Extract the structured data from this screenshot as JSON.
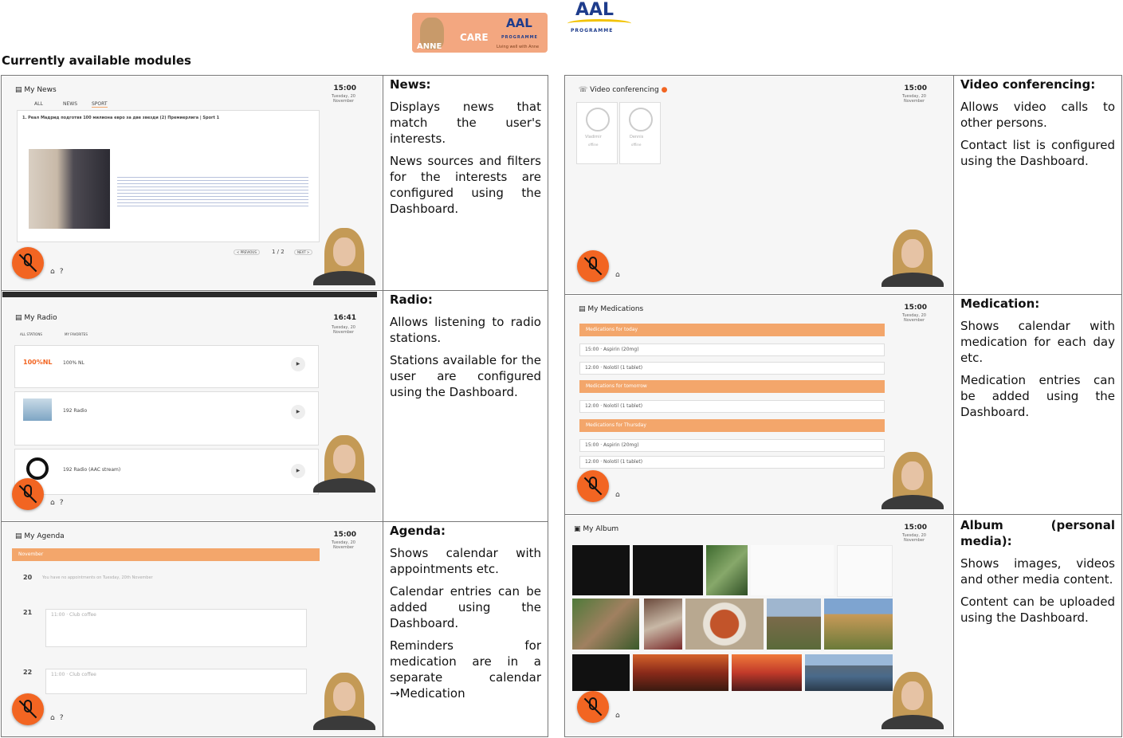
{
  "header": {
    "logo_anne": {
      "name": "ANNE",
      "care": "CARE",
      "aal": "AAL",
      "programme": "PROGRAMME",
      "tagline": "Living well with Anne"
    },
    "logo_aal": {
      "aal": "AAL",
      "programme": "PROGRAMME"
    },
    "heading": "Currently available modules"
  },
  "colors": {
    "accent": "#f3a66b",
    "mic": "#f26522"
  },
  "modules_left": [
    {
      "title": "News:",
      "paragraphs": [
        "Displays news that match the user's interests.",
        "News sources and filters for the interests are configured using the Dashboard."
      ],
      "app": {
        "title": "My News",
        "time": "15:00",
        "date": "Tuesday, 20 November",
        "tabs": [
          "ALL",
          "NEWS",
          "SPORT"
        ],
        "headline": "1. Реал Мадрид подготвя 100 милиона евро за две звезди (2) Премиерлига | Sport 1",
        "pager": "1 / 2",
        "prev": "< PREVIOUS",
        "next": "NEXT >"
      }
    },
    {
      "title": "Radio:",
      "paragraphs": [
        "Allows listening to radio stations.",
        "Stations available for the user are configured using the Dashboard."
      ],
      "app": {
        "title": "My Radio",
        "time": "16:41",
        "date": "Tuesday, 20 November",
        "filters": [
          "ALL STATIONS",
          "MY FAVORITES"
        ],
        "stations": [
          "100% NL",
          "192 Radio",
          "192 Radio (AAC stream)"
        ],
        "station_logo": "100%NL"
      }
    },
    {
      "title": "Agenda:",
      "paragraphs": [
        "Shows calendar with appointments etc.",
        "Calendar entries can be added using the Dashboard.",
        "Reminders for medication are in a separate calendar →Medication"
      ],
      "app": {
        "title": "My Agenda",
        "time": "15:00",
        "date": "Tuesday, 20 November",
        "month": "November",
        "days": [
          "20",
          "21",
          "22"
        ],
        "empty_note": "You have no appointments on Tuesday, 20th November",
        "entry": "11:00 · Club coffee"
      }
    }
  ],
  "modules_right": [
    {
      "title": "Video conferencing:",
      "paragraphs": [
        "Allows video calls to other persons.",
        "Contact list is configured using the Dashboard."
      ],
      "app": {
        "title": "Video conferencing",
        "time": "15:00",
        "date": "Tuesday, 20 November",
        "contacts": [
          "Vladimir",
          "Dennis"
        ],
        "status": "offline"
      }
    },
    {
      "title": "Medication:",
      "paragraphs": [
        "Shows calendar with medication for each day etc.",
        "Medication entries can be added using the Dashboard."
      ],
      "app": {
        "title": "My Medications",
        "time": "15:00",
        "date": "Tuesday, 20 November",
        "groups": [
          {
            "label": "Medications for today",
            "items": [
              "15:00 · Aspirin (20mg)",
              "12:00 · Nolotil (1 tablet)"
            ]
          },
          {
            "label": "Medications for tomorrow",
            "items": [
              "12:00 · Nolotil (1 tablet)"
            ]
          },
          {
            "label": "Medications for Thursday",
            "items": [
              "15:00 · Aspirin (20mg)",
              "12:00 · Nolotil (1 tablet)"
            ]
          }
        ]
      }
    },
    {
      "title": "Album (personal media):",
      "paragraphs": [
        "Shows images, videos and other media content.",
        "Content can be uploaded using the Dashboard."
      ],
      "app": {
        "title": "My Album",
        "time": "15:00",
        "date": "Tuesday, 20 November"
      }
    }
  ]
}
